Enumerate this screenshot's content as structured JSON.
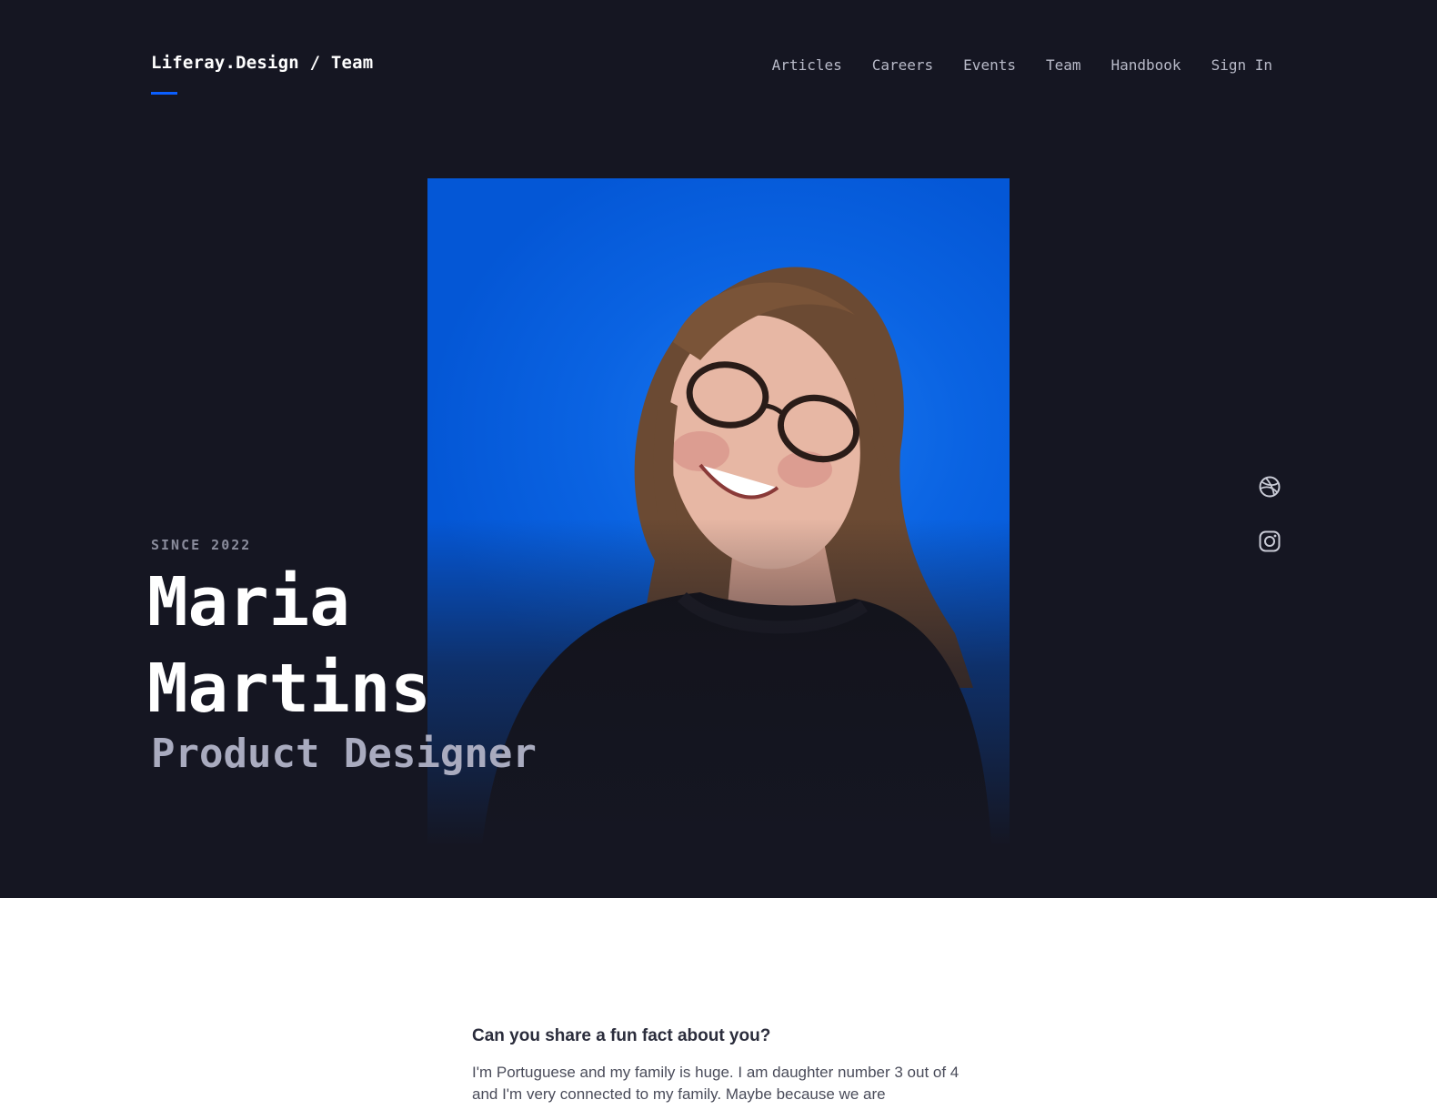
{
  "header": {
    "brand": "Liferay.Design / Team",
    "nav": [
      "Articles",
      "Careers",
      "Events",
      "Team",
      "Handbook",
      "Sign In"
    ]
  },
  "profile": {
    "since": "SINCE 2022",
    "first_name": "Maria",
    "last_name": "Martins",
    "role": "Product Designer",
    "photo_alt": "Portrait of Maria Martins",
    "social_icons": [
      "dribbble-icon",
      "instagram-icon"
    ]
  },
  "qa": {
    "question": "Can you share a fun fact about you?",
    "answer": "I'm Portuguese and my family is huge. I am daughter number 3 out of 4 and I'm very connected to my family. Maybe because we are"
  },
  "colors": {
    "hero_bg": "#151622",
    "accent": "#0b5fff",
    "photo_bg": "#0a63e2"
  }
}
